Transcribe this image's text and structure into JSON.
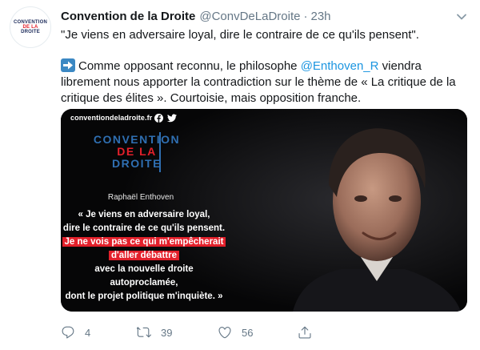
{
  "account": {
    "avatar_lines": [
      "CONVENTION",
      "DE LA",
      "DROITE"
    ],
    "name": "Convention de la Droite",
    "handle": "@ConvDeLaDroite",
    "separator": "·",
    "time": "23h"
  },
  "tweet": {
    "line1": "\"Je viens en adversaire loyal, dire le contraire de ce qu'ils pensent\".",
    "line2_before": "Comme opposant reconnu, le philosophe ",
    "mention": "@Enthoven_R",
    "line2_after": " viendra librement nous apporter la contradiction sur le thème de « La critique de la critique des élites ». Courtoisie, mais opposition franche.",
    "arrow_icon": "right-arrow-emoji"
  },
  "media": {
    "site": "conventiondeladroite.fr",
    "logo_lines": [
      "CONVENTION",
      "DE LA",
      "DROITE"
    ],
    "speaker": "Raphaël Enthoven",
    "quote_1": "« Je viens en adversaire loyal,",
    "quote_2": "dire le contraire de ce qu'ils pensent.",
    "quote_3": "Je ne vois pas ce qui m'empêcherait",
    "quote_4": "d'aller débattre",
    "quote_5": "avec la nouvelle droite autoproclamée,",
    "quote_6": "dont le projet politique m'inquiète. »",
    "colors": {
      "logo_blue": "#2f6fb2",
      "logo_red": "#e3202b",
      "highlight_red": "#e3202b"
    }
  },
  "actions": {
    "reply_count": "4",
    "retweet_count": "39",
    "like_count": "56"
  },
  "colors": {
    "link": "#1b95e0",
    "muted": "#657786",
    "text": "#14171a"
  }
}
